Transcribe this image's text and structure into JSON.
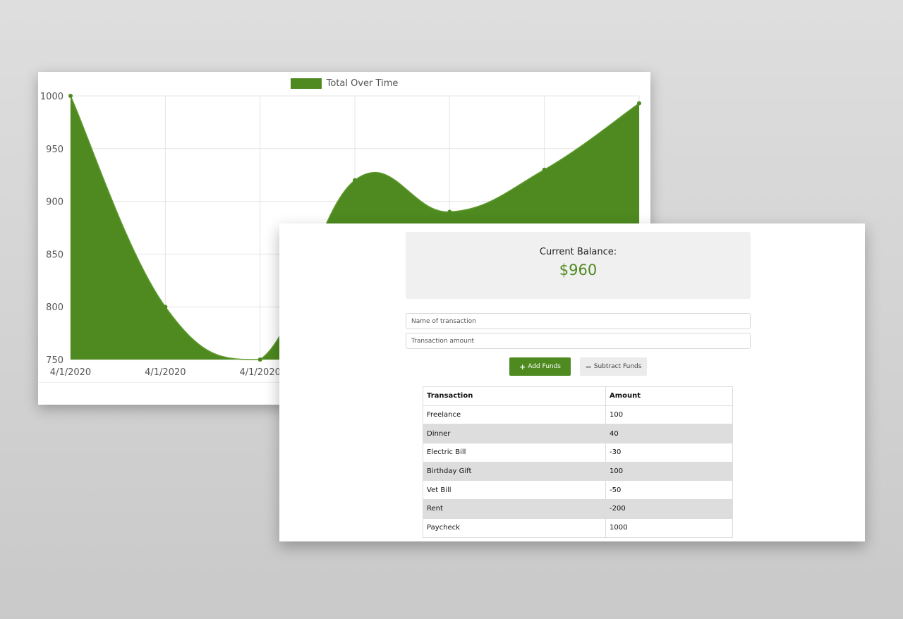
{
  "chart_data": {
    "type": "area",
    "legend": "Total Over Time",
    "legend_position": "top",
    "x": [
      "4/1/2020",
      "4/1/2020",
      "4/1/2020",
      "4/1/2020",
      "4/1/2020",
      "4/1/2020",
      "4/1/2020"
    ],
    "series": [
      {
        "name": "Total Over Time",
        "values": [
          1000,
          800,
          750,
          920,
          890,
          930,
          993
        ]
      }
    ],
    "ylim": [
      750,
      1000
    ],
    "yticks": [
      750,
      800,
      850,
      900,
      950,
      1000
    ],
    "grid": true,
    "color": "#4e8a1f"
  },
  "balance": {
    "title": "Current Balance:",
    "value": "$960"
  },
  "form": {
    "name_placeholder": "Name of transaction",
    "amount_placeholder": "Transaction amount",
    "add_label": "Add Funds",
    "add_icon": "plus-icon",
    "subtract_label": "Subtract Funds",
    "subtract_icon": "minus-icon"
  },
  "colors": {
    "accent": "#4e8a1f"
  },
  "table": {
    "headers": [
      "Transaction",
      "Amount"
    ],
    "rows": [
      [
        "Freelance",
        "100"
      ],
      [
        "Dinner",
        "40"
      ],
      [
        "Electric Bill",
        "-30"
      ],
      [
        "Birthday Gift",
        "100"
      ],
      [
        "Vet Bill",
        "-50"
      ],
      [
        "Rent",
        "-200"
      ],
      [
        "Paycheck",
        "1000"
      ]
    ]
  }
}
